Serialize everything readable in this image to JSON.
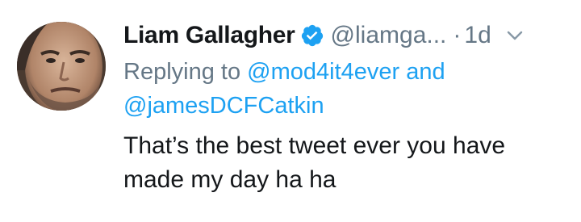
{
  "tweet": {
    "author_name": "Liam Gallagher",
    "handle": "@liamga...",
    "separator": "·",
    "time": "1d",
    "reply": {
      "prefix": "Replying to",
      "mention_1": "@mod4it4ever",
      "conjunction": "and",
      "mention_2": "@jamesDCFCatkin"
    },
    "text_line_1": "That’s the best tweet ever you have",
    "text_line_2": "made my day ha ha"
  },
  "icons": {
    "verified": "verified-badge-icon",
    "caret": "chevron-down-icon"
  },
  "colors": {
    "primary_text": "#14171a",
    "secondary_text": "#657786",
    "link": "#1da1f2",
    "verified": "#1da1f2",
    "background": "#ffffff"
  }
}
